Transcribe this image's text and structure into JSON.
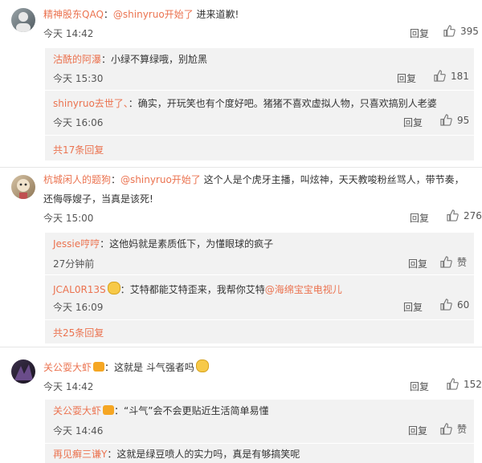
{
  "threads": [
    {
      "user": "精神股东QAQ",
      "sep": "：",
      "mention": "@shinyruo开始了",
      "text": " 进来道歉!",
      "text2": "",
      "time": "今天 14:42",
      "reply": "回复",
      "likes": "395",
      "replies": [
        {
          "user": "沽酰的阿瀑",
          "sep": "：",
          "text": "小绿不算绿哦，别尬黑",
          "time": "今天 15:30",
          "reply": "回复",
          "likes": "181"
        },
        {
          "user": "shinyruo去世了、",
          "sep": "：",
          "text": "确实，开玩笑也有个度好吧。猪猪不喜欢虚拟人物，只喜欢搞别人老婆",
          "time": "今天 16:06",
          "reply": "回复",
          "likes": "95"
        }
      ],
      "more": "共17条回复"
    },
    {
      "user": "杭城闲人的题狗",
      "sep": "：",
      "mention": "@shinyruo开始了",
      "text": " 这个人是个虎牙主播，叫炫神，天天教唆粉丝骂人，带节奏，",
      "text2": "还侮辱嫂子，当真是该死!",
      "time": "今天 15:00",
      "reply": "回复",
      "likes": "276",
      "replies": [
        {
          "user": "Jessie哼哼",
          "sep": "：",
          "text": "这他妈就是素质低下，为懂眼球的疯子",
          "time": "27分钟前",
          "reply": "回复",
          "likes": "赞"
        },
        {
          "user": "JCAL0R13S",
          "sep": "：",
          "text": "艾特都能艾特歪来，我帮你艾特",
          "mention": "@海绵宝宝电视儿",
          "time": "今天 16:09",
          "reply": "回复",
          "likes": "60"
        }
      ],
      "more": "共25条回复"
    },
    {
      "user": "关公耍大虾",
      "sep": "：",
      "mention": "",
      "text": "这就是 斗气强者吗",
      "text2": "",
      "time": "今天 14:42",
      "reply": "回复",
      "likes": "152",
      "replies": [
        {
          "user": "关公耍大虾",
          "sep": "：",
          "text": "“斗气”会不会更贴近生活简单易懂",
          "time": "今天 14:46",
          "reply": "回复",
          "likes": "赞"
        },
        {
          "user": "再见癣三谦Y",
          "sep": "：",
          "text": "这就是绿豆喷人的实力吗，真是有够搞笑呢",
          "time": "",
          "reply": "",
          "likes": ""
        }
      ],
      "more": ""
    }
  ],
  "colors": {
    "name": "#eb7350",
    "sub_bg": "#f2f2f2"
  },
  "icons": {
    "like": "thumbs-up-icon",
    "avatar": "user-avatar"
  }
}
